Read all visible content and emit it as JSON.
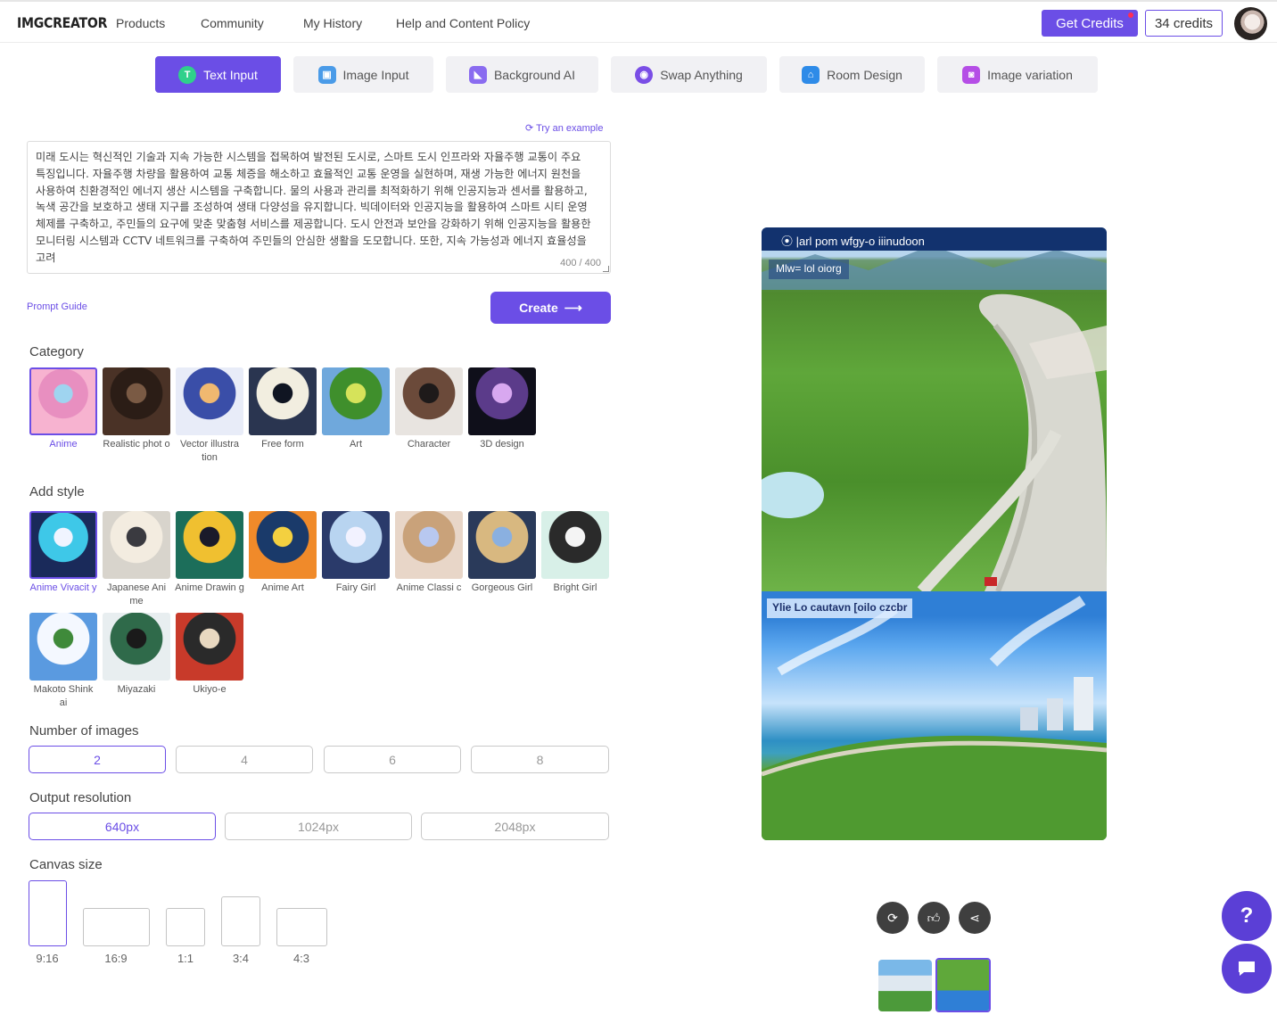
{
  "header": {
    "logo": "IMGCREATOR",
    "nav": [
      "Products",
      "Community",
      "My History",
      "Help and Content Policy"
    ],
    "get_credits": "Get Credits",
    "credits_count": "34 credits"
  },
  "modes": [
    {
      "label": "Text Input",
      "icon": "T",
      "color": "#2fd08b"
    },
    {
      "label": "Image Input",
      "icon": "▣",
      "color": "#4a9be8"
    },
    {
      "label": "Background AI",
      "icon": "◣",
      "color": "#8a6cf0"
    },
    {
      "label": "Swap Anything",
      "icon": "◉",
      "color": "#7a4ee6"
    },
    {
      "label": "Room Design",
      "icon": "⌂",
      "color": "#2e8be8"
    },
    {
      "label": "Image variation",
      "icon": "◙",
      "color": "#b54ee6"
    }
  ],
  "prompt": {
    "try_example": "Try an example",
    "text": "미래 도시는 혁신적인 기술과 지속 가능한 시스템을 접목하여 발전된 도시로, 스마트 도시 인프라와 자율주행 교통이 주요 특징입니다. 자율주행 차량을 활용하여 교통 체증을 해소하고 효율적인 교통 운영을 실현하며, 재생 가능한 에너지 원천을 사용하여 친환경적인 에너지 생산 시스템을 구축합니다. 물의 사용과 관리를 최적화하기 위해 인공지능과 센서를 활용하고, 녹색 공간을 보호하고 생태 지구를 조성하여 생태 다양성을 유지합니다. 빅데이터와 인공지능을 활용하여 스마트 시티 운영 체제를 구축하고, 주민들의 요구에 맞춘 맞춤형 서비스를 제공합니다. 도시 안전과 보안을 강화하기 위해 인공지능을 활용한 모니터링 시스템과 CCTV 네트워크를 구축하여 주민들의 안심한 생활을 도모합니다. 또한, 지속 가능성과 에너지 효율성을 고려",
    "char_count": "400 / 400",
    "prompt_guide": "Prompt Guide",
    "create": "Create"
  },
  "category": {
    "title": "Category",
    "items": [
      {
        "label": "Anime",
        "selected": true,
        "colors": [
          "#f7b3d0",
          "#e88fc0",
          "#9fd4f0"
        ]
      },
      {
        "label": "Realistic phot o",
        "selected": false,
        "colors": [
          "#4a3226",
          "#2b1d16",
          "#7a5a44"
        ]
      },
      {
        "label": "Vector illustra tion",
        "selected": false,
        "colors": [
          "#e8ecf8",
          "#3a4ea8",
          "#f0b870"
        ]
      },
      {
        "label": "Free form",
        "selected": false,
        "colors": [
          "#2a3550",
          "#f2eee0",
          "#101522"
        ]
      },
      {
        "label": "Art",
        "selected": false,
        "colors": [
          "#6fa8dc",
          "#3f8f2c",
          "#d6e35a"
        ]
      },
      {
        "label": "Character",
        "selected": false,
        "colors": [
          "#e8e4e0",
          "#6b4a3a",
          "#1e1a1a"
        ]
      },
      {
        "label": "3D design",
        "selected": false,
        "colors": [
          "#0f0f1a",
          "#5b3b8a",
          "#d8a8f0"
        ]
      }
    ]
  },
  "style": {
    "title": "Add style",
    "items": [
      {
        "label": "Anime Vivacit y",
        "selected": true,
        "colors": [
          "#1a2a5a",
          "#3ec8e8",
          "#f0f4ff"
        ]
      },
      {
        "label": "Japanese Ani me",
        "selected": false,
        "colors": [
          "#d8d4cc",
          "#f3ece0",
          "#3a3a40"
        ]
      },
      {
        "label": "Anime Drawin g",
        "selected": false,
        "colors": [
          "#1c6e5a",
          "#f0c030",
          "#1a1a2a"
        ]
      },
      {
        "label": "Anime Art",
        "selected": false,
        "colors": [
          "#f08a2a",
          "#1a3a6a",
          "#f4d040"
        ]
      },
      {
        "label": "Fairy Girl",
        "selected": false,
        "colors": [
          "#2a3a6a",
          "#b8d4f0",
          "#f2f2ff"
        ]
      },
      {
        "label": "Anime Classi c",
        "selected": false,
        "colors": [
          "#e8d6c8",
          "#c9a27a",
          "#b8c8f0"
        ]
      },
      {
        "label": "Gorgeous Girl",
        "selected": false,
        "colors": [
          "#2a3a5a",
          "#d8b880",
          "#8ab0e0"
        ]
      },
      {
        "label": "Bright Girl",
        "selected": false,
        "colors": [
          "#d8f0e8",
          "#2a2a2a",
          "#f4f4f4"
        ]
      },
      {
        "label": "Makoto Shink ai",
        "selected": false,
        "colors": [
          "#5a9ae0",
          "#f4f8ff",
          "#3f8a3a"
        ]
      },
      {
        "label": "Miyazaki",
        "selected": false,
        "colors": [
          "#e8eef0",
          "#2f6a4a",
          "#1a1a1a"
        ]
      },
      {
        "label": "Ukiyo-e",
        "selected": false,
        "colors": [
          "#c83a2a",
          "#2a2a2a",
          "#e8d8c0"
        ]
      }
    ]
  },
  "num_images": {
    "title": "Number of images",
    "options": [
      "2",
      "4",
      "6",
      "8"
    ],
    "selected": "2"
  },
  "resolution": {
    "title": "Output resolution",
    "options": [
      "640px",
      "1024px",
      "2048px"
    ],
    "selected": "640px"
  },
  "canvas": {
    "title": "Canvas size",
    "options": [
      "9:16",
      "16:9",
      "1:1",
      "3:4",
      "4:3"
    ],
    "selected": "9:16"
  },
  "preview": {
    "banner": "⦿ |arl pom wfgy-o iiinudoon",
    "caption_top": "Mlw= lol oiorg",
    "caption_bottom": "Ylie Lo cautavn [oilo czcbr"
  },
  "floating": {
    "help": "?"
  }
}
